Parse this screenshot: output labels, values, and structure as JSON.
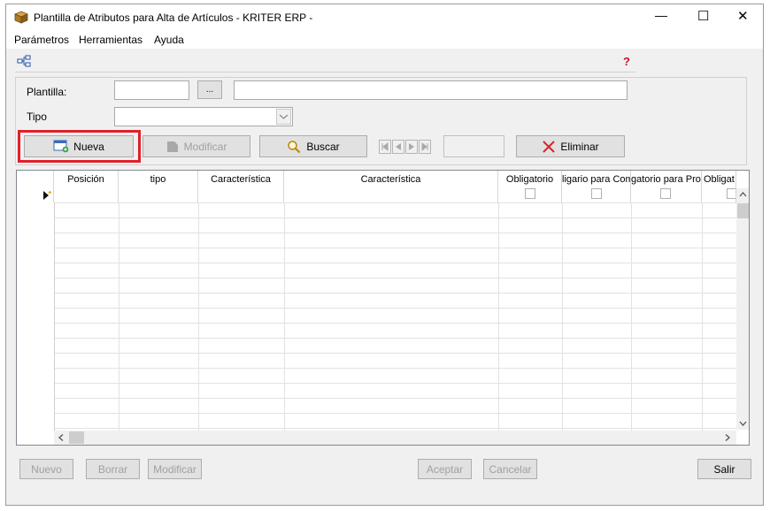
{
  "window": {
    "title": "Plantilla de Atributos para Alta de Artículos - KRITER ERP -",
    "minimize": "—",
    "maximize": "☐",
    "close": "✕"
  },
  "menu": [
    "Parámetros",
    "Herramientas",
    "Ayuda"
  ],
  "form": {
    "plantilla_label": "Plantilla:",
    "plantilla_value": "",
    "plantilla_desc": "",
    "browse_label": "...",
    "tipo_label": "Tipo",
    "tipo_value": ""
  },
  "toolbar": {
    "nueva": "Nueva",
    "modificar": "Modificar",
    "buscar": "Buscar",
    "eliminar": "Eliminar",
    "record_value": ""
  },
  "grid": {
    "columns": [
      "Posición",
      "tipo",
      "Característica",
      "Característica",
      "Obligatorio",
      "ligario para Com",
      "gatorio para Proc",
      "Obligat"
    ]
  },
  "footer": {
    "nuevo": "Nuevo",
    "borrar": "Borrar",
    "modificar": "Modificar",
    "aceptar": "Aceptar",
    "cancelar": "Cancelar",
    "salir": "Salir"
  },
  "colors": {
    "highlight": "#e0202a",
    "eliminar_x": "#d9232a"
  }
}
